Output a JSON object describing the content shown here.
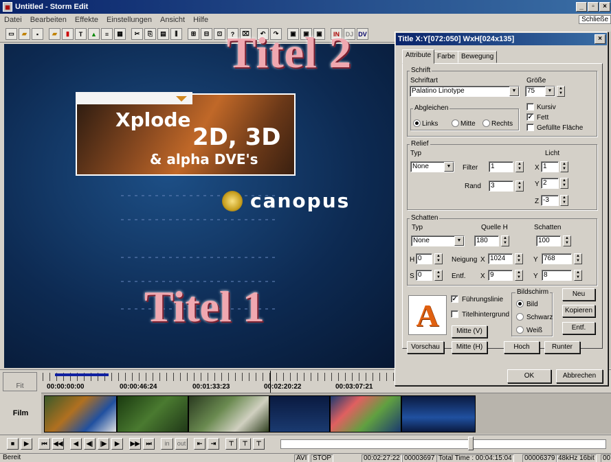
{
  "window": {
    "title": "Untitled - Storm Edit",
    "close_label": "Schließe"
  },
  "menu": [
    "Datei",
    "Bearbeiten",
    "Effekte",
    "Einstellungen",
    "Ansicht",
    "Hilfe"
  ],
  "preview": {
    "title2": "Titel 2",
    "title1": "Titel 1",
    "line1": "Xplode",
    "line2": "2D, 3D",
    "line3": "& alpha DVE's",
    "brand": "canopus"
  },
  "timeline": {
    "fit_label": "Fit",
    "timecodes": [
      "00:00:00:00",
      "00:00:46:24",
      "00:01:33:23",
      "00:02:20:22",
      "00:03:07:21"
    ],
    "track_label": "Film"
  },
  "transport": {
    "in_label": "in",
    "out_label": "out"
  },
  "status": {
    "ready": "Bereit",
    "format": "AVI",
    "state": "STOP",
    "position": "00:02:27:22",
    "frame": "00003697",
    "total": "Total Time : 00:04:15:04",
    "frames_total": "00006379",
    "audio": "48kHz 16bit",
    "extra": "00"
  },
  "dialog": {
    "title": "Title   X:Y[072:050] WxH[024x135]",
    "tabs": [
      "Attribute",
      "Farbe",
      "Bewegung"
    ],
    "schrift": {
      "group": "Schrift",
      "font_label": "Schriftart",
      "font_value": "Palatino Linotype",
      "size_label": "Größe",
      "size_value": "75",
      "align_group": "Abgleichen",
      "align_left": "Links",
      "align_center": "Mitte",
      "align_right": "Rechts",
      "italic": "Kursiv",
      "bold": "Fett",
      "filled": "Gefüllte Fläche"
    },
    "relief": {
      "group": "Relief",
      "type_label": "Typ",
      "type_value": "None",
      "filter_label": "Filter",
      "filter_value": "1",
      "rand_label": "Rand",
      "rand_value": "3",
      "light_label": "Licht",
      "x_label": "X",
      "x_value": "1",
      "y_label": "Y",
      "y_value": "2",
      "z_label": "Z",
      "z_value": "-3"
    },
    "schatten": {
      "group": "Schatten",
      "type_label": "Typ",
      "type_value": "None",
      "source_label": "Quelle H",
      "source_value": "180",
      "shadow_label": "Schatten",
      "shadow_value": "100",
      "h_label": "H",
      "h_value": "0",
      "s_label": "S",
      "s_value": "0",
      "neigung_label": "Neigung",
      "entf_label": "Entf.",
      "nx_label": "X",
      "nx_value": "1024",
      "ny_label": "Y",
      "ny_value": "768",
      "ex_label": "X",
      "ex_value": "9",
      "ey_label": "Y",
      "ey_value": "8"
    },
    "bottom": {
      "preview_letter": "A",
      "guideline": "Führungslinie",
      "title_bg": "Titelhintergrund",
      "center_v": "Mitte (V)",
      "center_h": "Mitte (H)",
      "vorschau": "Vorschau",
      "screen_group": "Bildschirm",
      "screen_image": "Bild",
      "screen_black": "Schwarz",
      "screen_white": "Weiß",
      "new": "Neu",
      "copy": "Kopieren",
      "delete": "Entf.",
      "up": "Hoch",
      "down": "Runter"
    },
    "ok": "OK",
    "cancel": "Abbrechen"
  }
}
